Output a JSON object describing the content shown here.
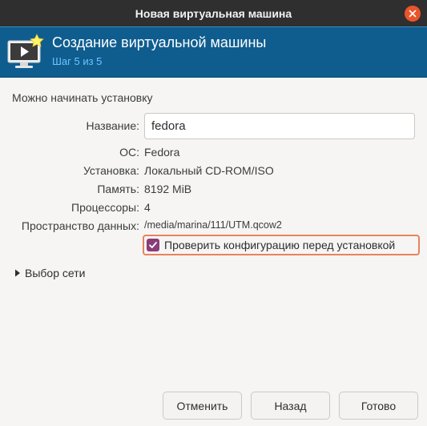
{
  "window": {
    "title": "Новая виртуальная машина"
  },
  "header": {
    "title": "Создание виртуальной машины",
    "step": "Шаг 5 из 5"
  },
  "section": {
    "label": "Можно начинать установку"
  },
  "form": {
    "name_label": "Название:",
    "name_value": "fedora",
    "os_label": "ОС:",
    "os_value": "Fedora",
    "install_label": "Установка:",
    "install_value": "Локальный CD-ROM/ISO",
    "memory_label": "Память:",
    "memory_value": "8192 MiB",
    "cpu_label": "Процессоры:",
    "cpu_value": "4",
    "storage_label": "Пространство данных:",
    "storage_value": "/media/marina/111/UTM.qcow2",
    "customize_label": "Проверить конфигурацию перед установкой",
    "customize_checked": true
  },
  "network": {
    "label": "Выбор сети",
    "expanded": false
  },
  "buttons": {
    "cancel": "Отменить",
    "back": "Назад",
    "finish": "Готово"
  },
  "colors": {
    "titlebar": "#2f2f2f",
    "banner": "#0f5d8f",
    "step_text": "#6fc3ff",
    "close": "#e9552a",
    "checkbox": "#8a3d78",
    "focus_ring": "#e9825d"
  }
}
